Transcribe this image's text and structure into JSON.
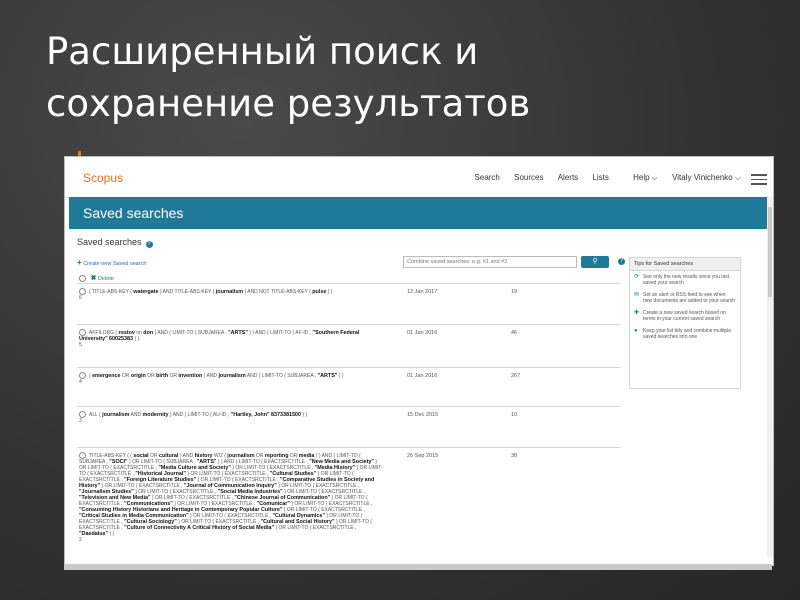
{
  "slide": {
    "title_line1": "Расширенный поиск и",
    "title_line2": "сохранение результатов"
  },
  "app": {
    "logo": "Scopus",
    "nav": {
      "search": "Search",
      "sources": "Sources",
      "alerts": "Alerts",
      "lists": "Lists",
      "help": "Help ⌵",
      "user": "Vitaly Vinichenko ⌵"
    },
    "banner_title": "Saved searches"
  },
  "main": {
    "heading": "Saved searches",
    "create_link": "Create new Saved search",
    "combine_placeholder": "Combine saved searches: e.g. #1 and #2",
    "delete_label": "Delete",
    "rows": [
      {
        "num": "6",
        "date": "12 Jan 2017",
        "count": "19",
        "q": "( TITLE-ABS-KEY ( <b>watergate</b> ) AND TITLE-ABS-KEY ( <b>journalism</b> ) AND NOT TITLE-ABS-KEY ( <b>pulse</b> ) )"
      },
      {
        "num": "5",
        "date": "01 Jan 2016",
        "count": "46",
        "q": "AFFILORG ( <b>rostov</b> on <b>don</b> ) AND ( LIMIT-TO ( SUBJAREA , <b>\"ARTS\"</b> ) ) AND ( LIMIT-TO ( AF-ID , <b>\"Southern Federal University\"</b> <b>60025383</b> ) )"
      },
      {
        "num": "4",
        "date": "01 Jan 2016",
        "count": "267",
        "q": "( <b>emergence</b> OR <b>origin</b> OR <b>birth</b> OR <b>invention</b> ) AND <b>journalism</b> AND ( LIMIT-TO ( SUBJAREA , <b>\"ARTS\"</b> ) )"
      },
      {
        "num": "3",
        "date": "15 Dec 2015",
        "count": "10",
        "q": "ALL ( <b>journalism</b> AND <b>modernity</b> ) AND ( LIMIT-TO ( AU-ID , <b>\"Hartley, John\"</b> <b>8373381500</b> ) )"
      },
      {
        "num": "2",
        "date": "26 Sep 2015",
        "count": "38",
        "q": "TITLE-ABS-KEY ( ( <b>social</b> OR <b>cultural</b> ) AND <b>history</b> W/2 ( <b>journalism</b> OR <b>reporting</b> OR <b>media</b> ) ) AND ( LIMIT-TO ( SUBJAREA , <b>\"SOCI\"</b> ) OR LIMIT-TO ( SUBJAREA , <b>\"ARTS\"</b> ) ) AND ( LIMIT-TO ( EXACTSRCTITLE , <b>\"New Media and Society\"</b> ) OR LIMIT-TO ( EXACTSRCTITLE , <b>\"Media Culture and Society\"</b> ) OR LIMIT-TO ( EXACTSRCTITLE , <b>\"Media History\"</b> ) OR LIMIT-TO ( EXACTSRCTITLE , <b>\"Historical Journal\"</b> ) OR LIMIT-TO ( EXACTSRCTITLE , <b>\"Cultural Studies\"</b> ) OR LIMIT-TO ( EXACTSRCTITLE , <b>\"Foreign Literature Studies\"</b> ) OR LIMIT-TO ( EXACTSRCTITLE , <b>\"Comparative Studies in Society and History\"</b> ) OR LIMIT-TO ( EXACTSRCTITLE , <b>\"Journal of Communication Inquiry\"</b> ) OR LIMIT-TO ( EXACTSRCTITLE , <b>\"Journalism Studies\"</b> ) OR LIMIT-TO ( EXACTSRCTITLE , <b>\"Social Media Industries\"</b> ) OR LIMIT-TO ( EXACTSRCTITLE , <b>\"Television and New Media\"</b> ) OR LIMIT-TO ( EXACTSRCTITLE , <b>\"Chinese Journal of Communication\"</b> ) OR LIMIT-TO ( EXACTSRCTITLE , <b>\"Communications\"</b> ) OR LIMIT-TO ( EXACTSRCTITLE , <b>\"Comunicar\"</b> ) OR LIMIT-TO ( EXACTSRCTITLE , <b>\"Consuming History Historians and Heritage in Contemporary Popular Culture\"</b> ) OR LIMIT-TO ( EXACTSRCTITLE , <b>\"Critical Studies in Media Communication\"</b> ) OR LIMIT-TO ( EXACTSRCTITLE , <b>\"Cultural Dynamics\"</b> ) OR LIMIT-TO ( EXACTSRCTITLE , <b>\"Cultural Sociology\"</b> ) OR LIMIT-TO ( EXACTSRCTITLE , <b>\"Cultural and Social History\"</b> ) OR LIMIT-TO ( EXACTSRCTITLE , <b>\"Culture of Connectivity A Critical History of Social Media\"</b> ) OR LIMIT-TO ( EXACTSRCTITLE , <b>\"Daedalus\"</b> ) )"
      }
    ]
  },
  "tips": {
    "title": "Tips for Saved searches",
    "items": [
      {
        "icon": "⟳",
        "text": "See only the new results since you last saved your search"
      },
      {
        "icon": "✉",
        "text": "Set an alert or RSS feed to see when new documents are added to your search"
      },
      {
        "icon": "✚",
        "text": "Create a new saved search based on terms in your current saved search"
      },
      {
        "icon": "●",
        "text": "Keep your list tidy and combine multiple saved searches into one"
      }
    ]
  },
  "colors": {
    "accent": "#1f7a9a",
    "brand": "#e9711c"
  }
}
